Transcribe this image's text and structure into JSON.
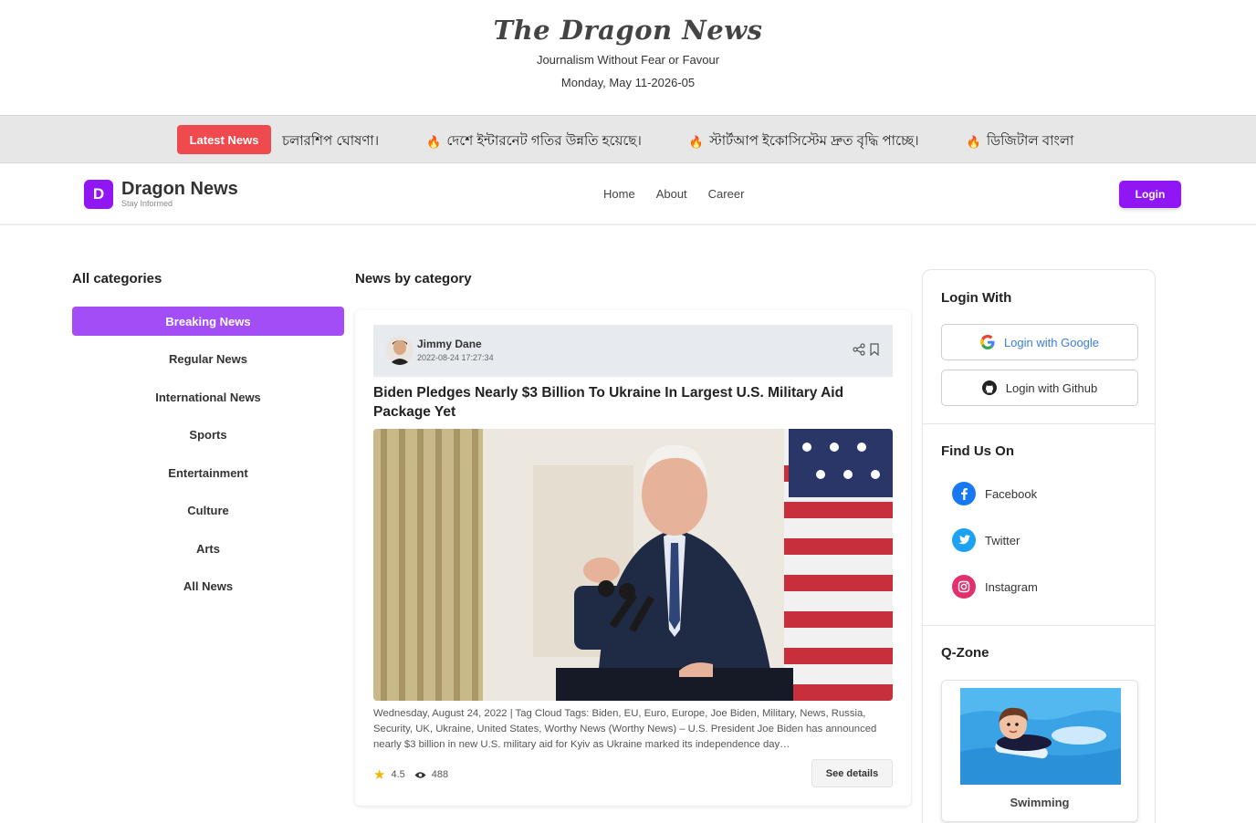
{
  "masthead": {
    "title": "The Dragon News",
    "tagline": "Journalism Without Fear or Favour",
    "date": "Monday, May 11-2026-05"
  },
  "ticker": {
    "latest_label": "Latest News",
    "items": [
      "চলারশিপ ঘোষণা।",
      "দেশে ইন্টারনেট গতির উন্নতি হয়েছে।",
      "স্টার্টআপ ইকোসিস্টেম দ্রুত বৃদ্ধি পাচ্ছে।",
      "ডিজিটাল বাংলা"
    ]
  },
  "navbar": {
    "brand_letter": "D",
    "brand_name": "Dragon News",
    "brand_sub": "Stay Informed",
    "links": [
      "Home",
      "About",
      "Career"
    ],
    "login_label": "Login"
  },
  "left": {
    "heading": "All categories",
    "categories": [
      "Breaking News",
      "Regular News",
      "International News",
      "Sports",
      "Entertainment",
      "Culture",
      "Arts",
      "All News"
    ]
  },
  "center": {
    "heading": "News by category",
    "article": {
      "author": "Jimmy Dane",
      "published": "2022-08-24 17:27:34",
      "title": "Biden Pledges Nearly $3 Billion To Ukraine In Largest U.S. Military Aid Package Yet",
      "excerpt": "Wednesday, August 24, 2022 | Tag Cloud Tags: Biden, EU, Euro, Europe, Joe Biden, Military, News, Russia, Security, UK, Ukraine, United States, Worthy News (Worthy News) – U.S. President Joe Biden has announced nearly $3 billion in new U.S. military aid for Kyiv as Ukraine marked its independence day…",
      "rating": "4.5",
      "views": "488",
      "details_label": "See details"
    }
  },
  "right": {
    "login_heading": "Login With",
    "google_label": "Login with Google",
    "github_label": "Login with Github",
    "find_heading": "Find Us On",
    "socials": [
      "Facebook",
      "Twitter",
      "Instagram"
    ],
    "qzone_heading": "Q-Zone",
    "qzone_label": "Swimming"
  },
  "colors": {
    "accent": "#9017f3",
    "category_active": "#a24df5",
    "latest_red": "#ef4a4d",
    "facebook": "#1877f2",
    "twitter": "#1da1f2",
    "instagram": "#e1306c"
  }
}
